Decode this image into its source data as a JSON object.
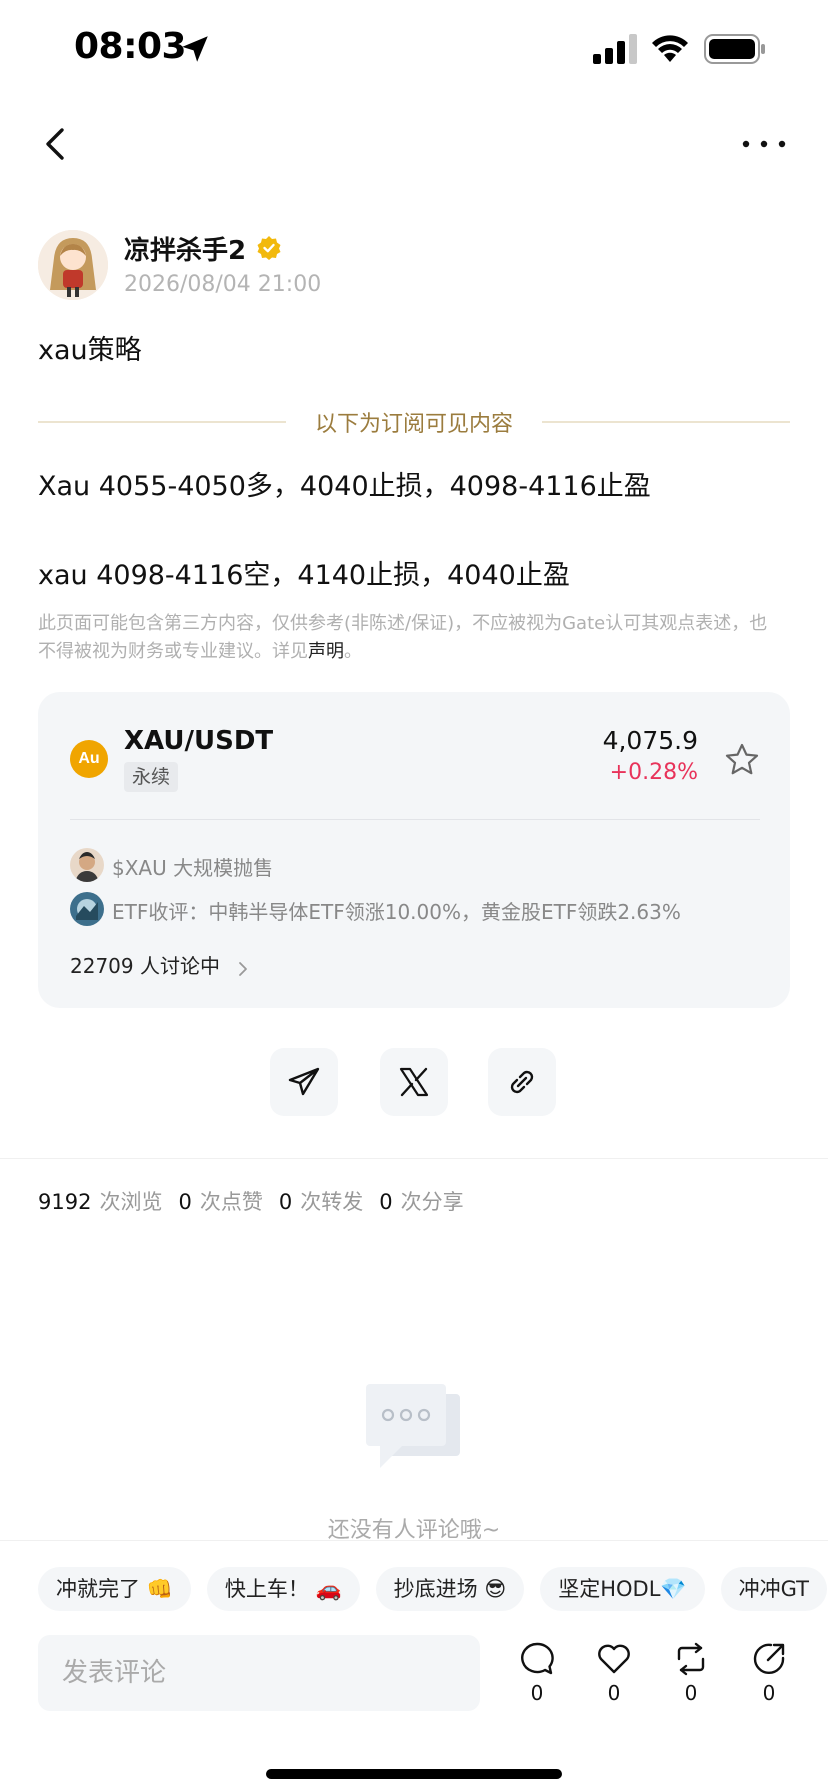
{
  "status_bar": {
    "time": "08:03"
  },
  "author": {
    "name": "凉拌杀手2",
    "time": "2026/08/04 21:00"
  },
  "post": {
    "title": "xau策略",
    "subscription_divider": "以下为订阅可见内容",
    "lines": [
      "Xau 4055-4050多，4040止损，4098-4116止盈",
      "xau 4098-4116空，4140止损，4040止盈"
    ],
    "disclaimer": "此页面可能包含第三方内容，仅供参考(非陈述/保证)，不应被视为Gate认可其观点表述，也不得被视为财务或专业建议。详见",
    "disclaimer_link": "声明",
    "disclaimer_end": "。"
  },
  "market": {
    "icon_text": "Au",
    "pair": "XAU/USDT",
    "tag": "永续",
    "price": "4,075.9",
    "change": "+0.28%",
    "change_color": "#e8335a",
    "news": [
      "$XAU 大规模抛售",
      "ETF收评：中韩半导体ETF领涨10.00%，黄金股ETF领跌2.63%"
    ],
    "discussion": "22709 人讨论中"
  },
  "stats": {
    "views": "9192",
    "views_label": "次浏览",
    "likes": "0",
    "likes_label": "次点赞",
    "reposts": "0",
    "reposts_label": "次转发",
    "shares": "0",
    "shares_label": "次分享"
  },
  "comments": {
    "empty_text": "还没有人评论哦~"
  },
  "quick_replies": [
    "冲就完了 👊",
    "快上车！ 🚗",
    "抄底进场 😎",
    "坚定HODL💎",
    "冲冲GT"
  ],
  "comment_box": {
    "placeholder": "发表评论"
  },
  "actions": {
    "comment_count": "0",
    "like_count": "0",
    "repost_count": "0",
    "share_count": "0"
  },
  "icons": {
    "back": "chevron-left-icon",
    "more": "more-horizontal-icon",
    "verified": "verified-badge-icon",
    "star": "star-outline-icon",
    "telegram": "telegram-icon",
    "x": "x-logo-icon",
    "link": "link-icon"
  }
}
